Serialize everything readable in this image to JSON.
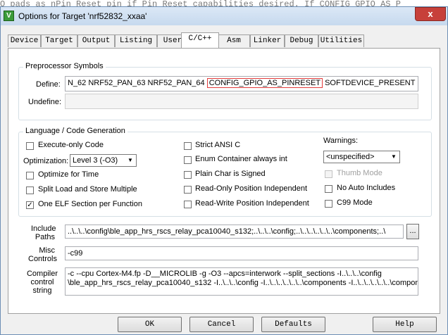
{
  "background_text": "O pads as nPin Reset pin if Pin Reset capabilities desired. If CONFIG_GPIO_AS_P",
  "window": {
    "title": "Options for Target 'nrf52832_xxaa'",
    "close_label": "x"
  },
  "tabs": [
    {
      "label": "Device"
    },
    {
      "label": "Target"
    },
    {
      "label": "Output"
    },
    {
      "label": "Listing"
    },
    {
      "label": "User"
    },
    {
      "label": "C/C++"
    },
    {
      "label": "Asm"
    },
    {
      "label": "Linker"
    },
    {
      "label": "Debug"
    },
    {
      "label": "Utilities"
    }
  ],
  "preprocessor": {
    "group_title": "Preprocessor Symbols",
    "define_label": "Define:",
    "define_before": "N_62 NRF52_PAN_63 NRF52_PAN_64 ",
    "define_highlight": "CONFIG_GPIO_AS_PINRESET",
    "define_after": " SOFTDEVICE_PRESENT NR",
    "undefine_label": "Undefine:",
    "undefine_value": ""
  },
  "codegen": {
    "group_title": "Language / Code Generation",
    "execute_only": {
      "label": "Execute-only Code",
      "checked": false
    },
    "optimization_label": "Optimization:",
    "optimization_value": "Level 3 (-O3)",
    "optimize_time": {
      "label": "Optimize for Time",
      "checked": false
    },
    "split_load": {
      "label": "Split Load and Store Multiple",
      "checked": false
    },
    "one_elf": {
      "label": "One ELF Section per Function",
      "checked": true
    },
    "strict_ansi": {
      "label": "Strict ANSI C",
      "checked": false
    },
    "enum_container": {
      "label": "Enum Container always int",
      "checked": false
    },
    "plain_char": {
      "label": "Plain Char is Signed",
      "checked": false
    },
    "ro_pi": {
      "label": "Read-Only Position Independent",
      "checked": false
    },
    "rw_pi": {
      "label": "Read-Write Position Independent",
      "checked": false
    },
    "warnings_label": "Warnings:",
    "warnings_value": "<unspecified>",
    "thumb_mode": {
      "label": "Thumb Mode",
      "checked": false
    },
    "no_auto_includes": {
      "label": "No Auto Includes",
      "checked": false
    },
    "c99_mode": {
      "label": "C99 Mode",
      "checked": false
    }
  },
  "include": {
    "label_line1": "Include",
    "label_line2": "Paths",
    "value": "..\\..\\..\\config\\ble_app_hrs_rscs_relay_pca10040_s132;..\\..\\..\\config;..\\..\\..\\..\\..\\..\\components;..\\",
    "browse_label": "..."
  },
  "misc": {
    "label_line1": "Misc",
    "label_line2": "Controls",
    "value": "-c99"
  },
  "compiler": {
    "label_line1": "Compiler",
    "label_line2": "control",
    "label_line3": "string",
    "line1": "-c --cpu Cortex-M4.fp -D__MICROLIB -g -O3 --apcs=interwork --split_sections -I..\\..\\..\\config",
    "line2": "\\ble_app_hrs_rscs_relay_pca10040_s132 -I..\\..\\..\\config -I..\\..\\..\\..\\..\\..\\components -I..\\..\\..\\..\\..\\..\\components\\libraries"
  },
  "buttons": {
    "ok": "OK",
    "cancel": "Cancel",
    "defaults": "Defaults",
    "help": "Help"
  }
}
